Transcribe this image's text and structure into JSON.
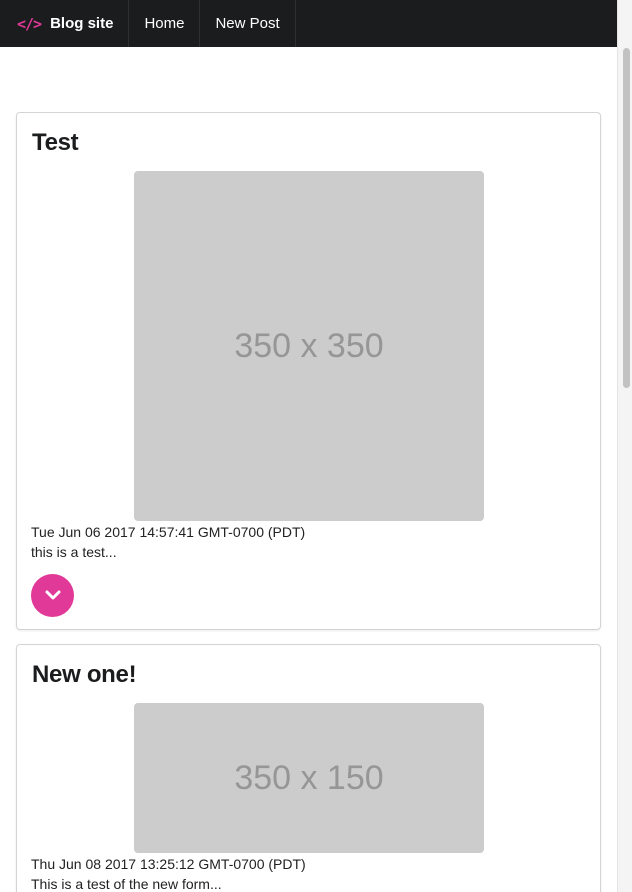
{
  "navbar": {
    "brand_icon": "code-icon",
    "brand_icon_glyph": "</>",
    "brand_label": "Blog site",
    "items": [
      {
        "label": "Home"
      },
      {
        "label": "New Post"
      }
    ]
  },
  "colors": {
    "navbar_bg": "#1b1c1d",
    "accent": "#e03997",
    "placeholder_bg": "#cccccc"
  },
  "posts": [
    {
      "title": "Test",
      "image_text": "350 x 350",
      "date": "Tue Jun 06 2017 14:57:41 GMT-0700 (PDT)",
      "excerpt": "this is a test...",
      "expand_icon": "chevron-down-icon"
    },
    {
      "title": "New one!",
      "image_text": "350 x 150",
      "date": "Thu Jun 08 2017 13:25:12 GMT-0700 (PDT)",
      "excerpt": "This is a test of the new form..."
    }
  ]
}
